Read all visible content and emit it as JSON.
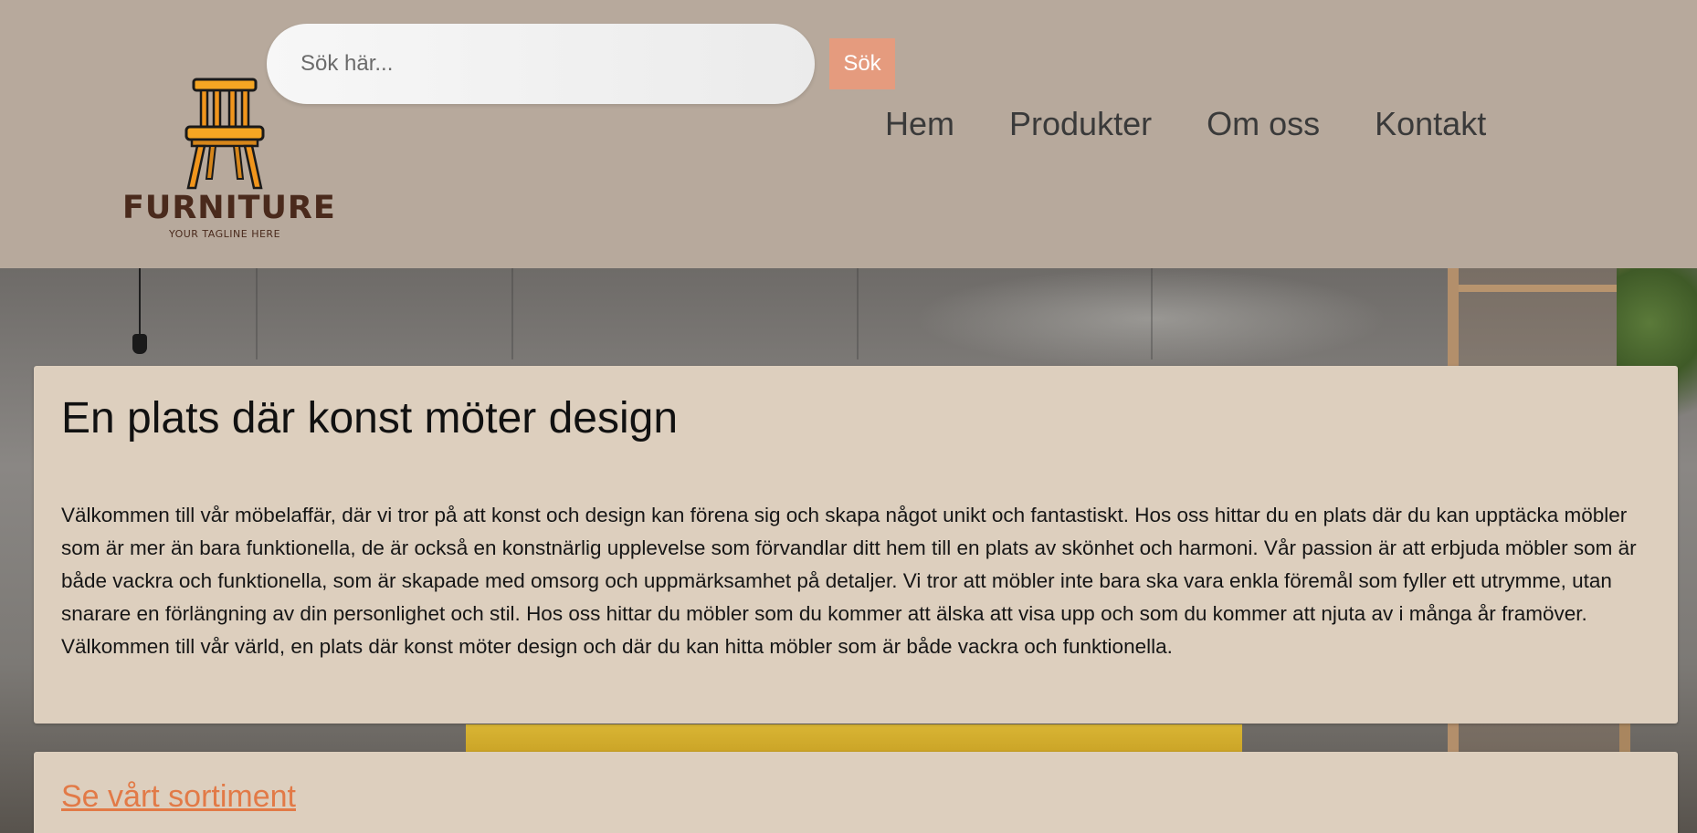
{
  "header": {
    "logo": {
      "brand": "FURNITURE",
      "tagline": "YOUR TAGLINE HERE",
      "icon": "chair-icon"
    },
    "search": {
      "placeholder": "Sök här...",
      "value": "",
      "button_label": "Sök"
    },
    "nav": [
      {
        "label": "Hem"
      },
      {
        "label": "Produkter"
      },
      {
        "label": "Om oss"
      },
      {
        "label": "Kontakt"
      }
    ]
  },
  "main": {
    "intro": {
      "heading": "En plats där konst möter design",
      "body": "Välkommen till vår möbelaffär, där vi tror på att konst och design kan förena sig och skapa något unikt och fantastiskt. Hos oss hittar du en plats där du kan upptäcka möbler som är mer än bara funktionella, de är också en konstnärlig upplevelse som förvandlar ditt hem till en plats av skönhet och harmoni. Vår passion är att erbjuda möbler som är både vackra och funktionella, som är skapade med omsorg och uppmärksamhet på detaljer. Vi tror att möbler inte bara ska vara enkla föremål som fyller ett utrymme, utan snarare en förlängning av din personlighet och stil. Hos oss hittar du möbler som du kommer att älska att visa upp och som du kommer att njuta av i många år framöver. Välkommen till vår värld, en plats där konst möter design och där du kan hitta möbler som är både vackra och funktionella."
    },
    "range_link": "Se vårt sortiment"
  },
  "colors": {
    "header_bg": "#b7a99c",
    "card_bg": "#ddcfbe",
    "search_button_bg": "#e59b7e",
    "link": "#e27a47",
    "logo_brown": "#4a2a1c",
    "chair_orange": "#f5a623"
  }
}
